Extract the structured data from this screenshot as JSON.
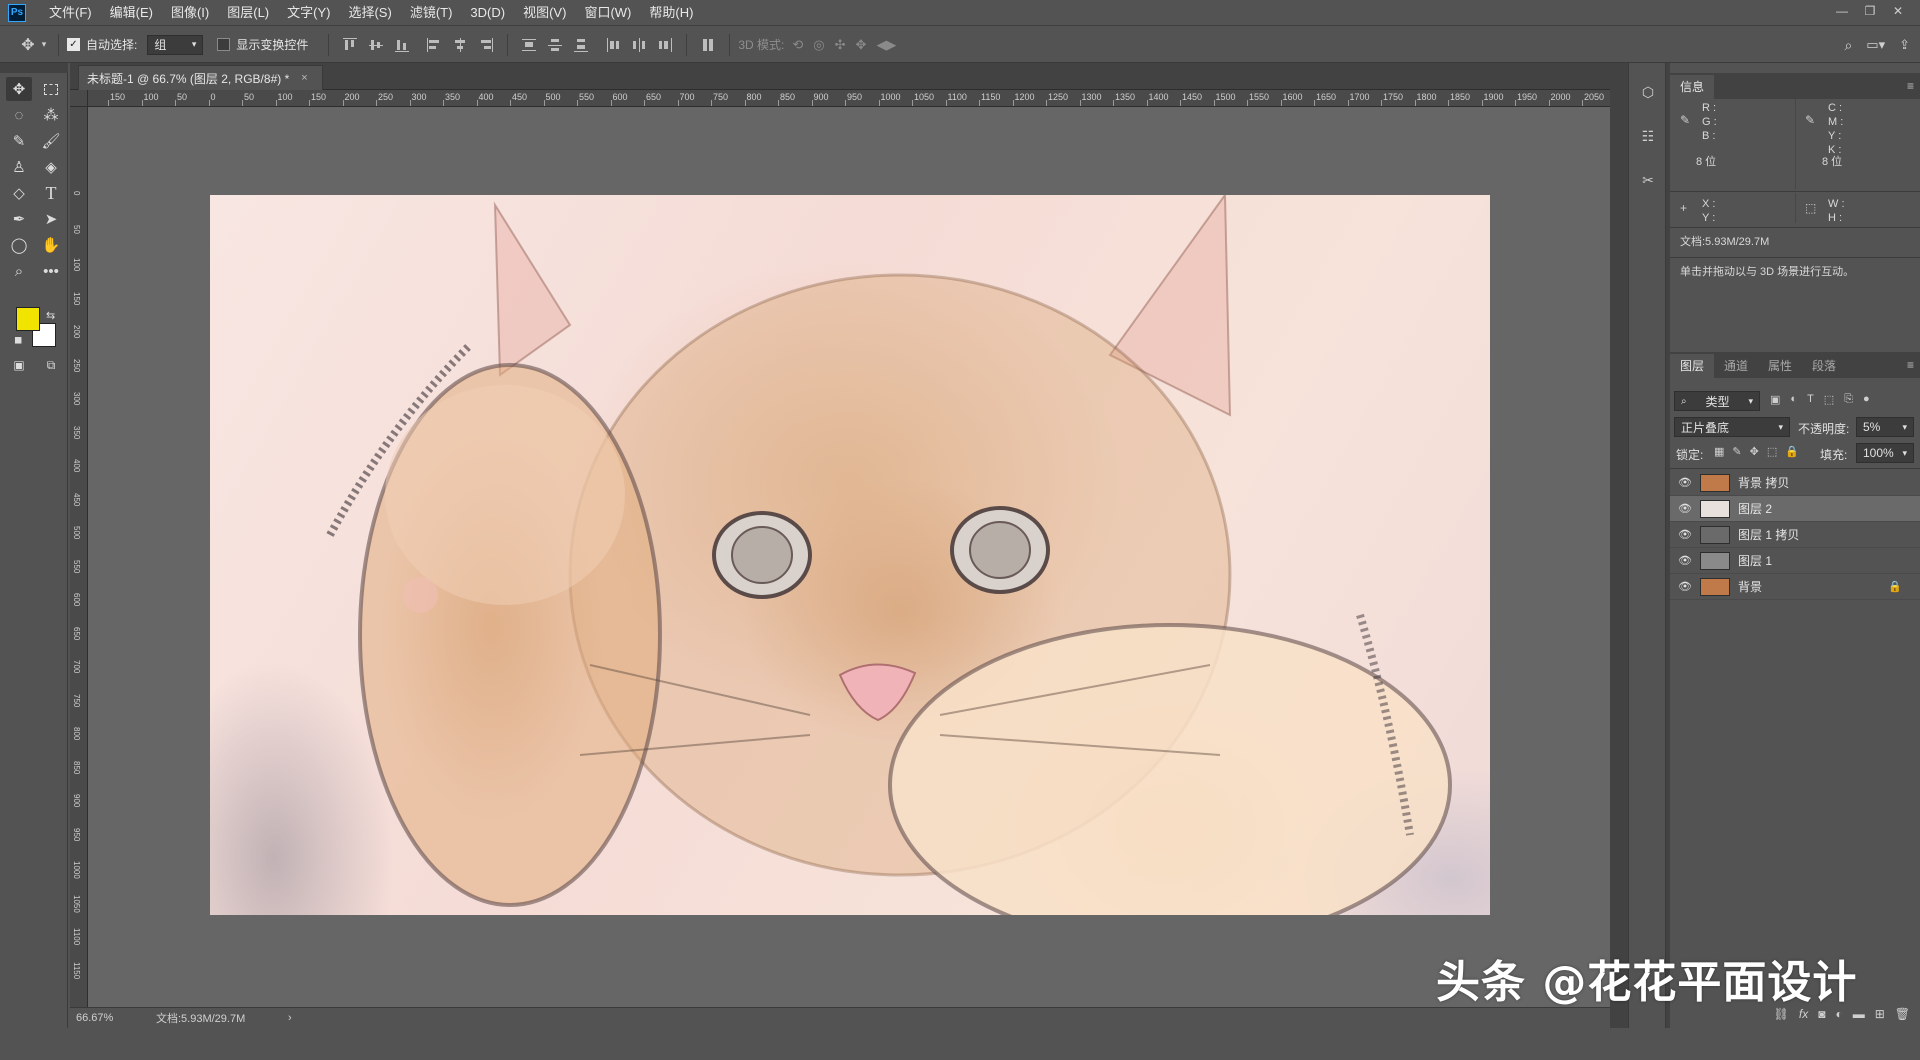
{
  "app": {
    "logo": "Ps"
  },
  "menu": [
    "文件(F)",
    "编辑(E)",
    "图像(I)",
    "图层(L)",
    "文字(Y)",
    "选择(S)",
    "滤镜(T)",
    "3D(D)",
    "视图(V)",
    "窗口(W)",
    "帮助(H)"
  ],
  "options": {
    "auto_select_label": "自动选择:",
    "auto_select_checked": true,
    "auto_select_value": "组",
    "show_transform_label": "显示变换控件",
    "mode_3d_label": "3D 模式:"
  },
  "document": {
    "tab_title": "未标题-1 @ 66.7% (图层 2, RGB/8#) *",
    "ruler_h": [
      "150",
      "100",
      "50",
      "0",
      "50",
      "100",
      "150",
      "200",
      "250",
      "300",
      "350",
      "400",
      "450",
      "500",
      "550",
      "600",
      "650",
      "700",
      "750",
      "800",
      "850",
      "900",
      "950",
      "1000",
      "1050",
      "1100",
      "1150",
      "1200",
      "1250",
      "1300",
      "1350",
      "1400",
      "1450",
      "1500",
      "1550",
      "1600",
      "1650",
      "1700",
      "1750",
      "1800",
      "1850",
      "1900",
      "1950",
      "2000",
      "2050"
    ],
    "ruler_v": [
      "0",
      "50",
      "100",
      "150",
      "200",
      "250",
      "300",
      "350",
      "400",
      "450",
      "500",
      "550",
      "600",
      "650",
      "700",
      "750",
      "800",
      "850",
      "900",
      "950",
      "1000",
      "1050",
      "1100",
      "1150"
    ]
  },
  "status": {
    "zoom": "66.67%",
    "doc_size": "文档:5.93M/29.7M",
    "arrow": "›"
  },
  "info_panel": {
    "tab": "信息",
    "rgb_labels": [
      "R :",
      "G :",
      "B :"
    ],
    "cmyk_labels": [
      "C :",
      "M :",
      "Y :",
      "K :"
    ],
    "bit_left": "8 位",
    "bit_right": "8 位",
    "xy_labels": [
      "X :",
      "Y :"
    ],
    "wh_labels": [
      "W :",
      "H :"
    ],
    "doc": "文档:5.93M/29.7M",
    "hint": "单击并拖动以与 3D 场景进行互动。"
  },
  "layers_panel": {
    "tabs": [
      "图层",
      "通道",
      "属性",
      "段落"
    ],
    "filter_label": "类型",
    "blend_mode": "正片叠底",
    "opacity_label": "不透明度:",
    "opacity_value": "5%",
    "lock_label": "锁定:",
    "fill_label": "填充:",
    "fill_value": "100%",
    "layers": [
      {
        "name": "背景 拷贝",
        "selected": false,
        "locked": false,
        "thumb": "#c07a4a"
      },
      {
        "name": "图层 2",
        "selected": true,
        "locked": false,
        "thumb": "#e8e0dc"
      },
      {
        "name": "图层 1 拷贝",
        "selected": false,
        "locked": false,
        "thumb": "#6a6a6a"
      },
      {
        "name": "图层 1",
        "selected": false,
        "locked": false,
        "thumb": "#8a8a8a"
      },
      {
        "name": "背景",
        "selected": false,
        "locked": true,
        "thumb": "#c07a4a"
      }
    ]
  },
  "colors": {
    "foreground": "#f0e400",
    "background": "#ffffff"
  },
  "watermark": "头条 @花花平面设计"
}
